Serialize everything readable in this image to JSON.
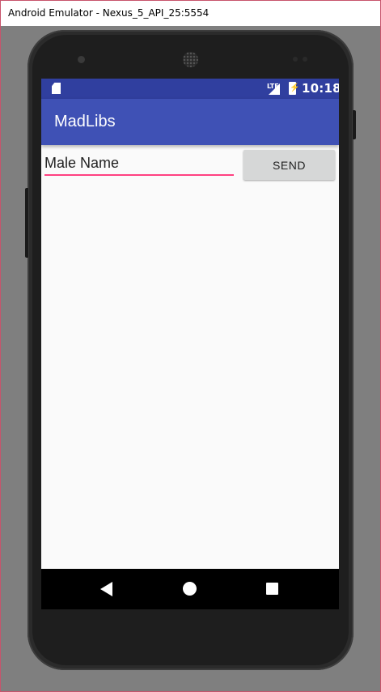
{
  "window": {
    "title": "Android Emulator - Nexus_5_API_25:5554"
  },
  "device": {
    "frame_color": "#2b2b2b"
  },
  "status_bar": {
    "network": "LTE",
    "time": "10:18",
    "battery_icon": "battery-charging-icon",
    "signal_icon": "signal-icon",
    "sd_icon": "sd-card-icon",
    "color": "#303f9f"
  },
  "app_bar": {
    "title": "MadLibs",
    "color": "#3f51b5"
  },
  "form": {
    "name_input": {
      "value": "",
      "placeholder": "Male Name",
      "underline_color": "#ff4081"
    },
    "send_label": "SEND"
  },
  "nav_bar": {
    "back": "back-icon",
    "home": "home-icon",
    "recents": "recents-icon"
  }
}
